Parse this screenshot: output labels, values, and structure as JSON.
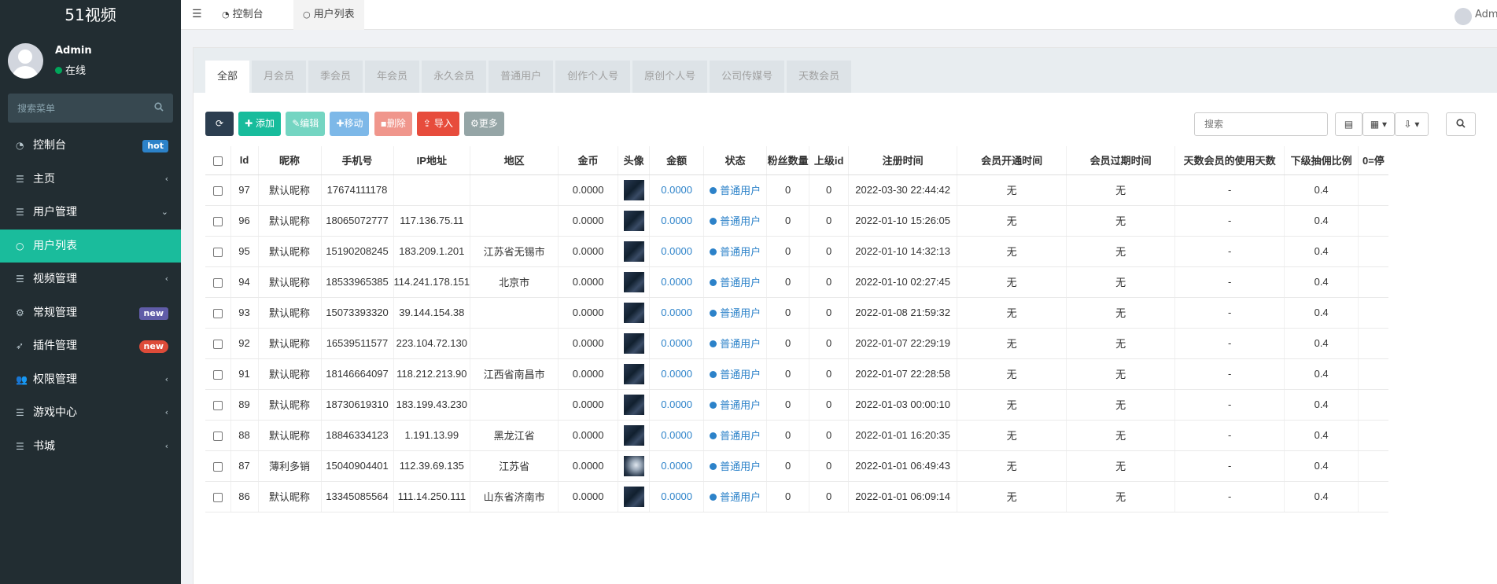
{
  "app": {
    "brand": "51视频",
    "user": {
      "name": "Admin",
      "status": "在线"
    },
    "search_placeholder": "搜索菜单"
  },
  "menu": [
    {
      "label": "控制台",
      "icon": "dashboard-icon",
      "badge": "hot"
    },
    {
      "label": "主页",
      "icon": "list-icon",
      "chevron": "left"
    },
    {
      "label": "用户管理",
      "icon": "list-icon",
      "chevron": "down"
    },
    {
      "label": "用户列表",
      "icon": "circle-icon",
      "active": true
    },
    {
      "label": "视频管理",
      "icon": "list-icon",
      "chevron": "left"
    },
    {
      "label": "常规管理",
      "icon": "gears-icon",
      "badge": "new"
    },
    {
      "label": "插件管理",
      "icon": "rocket-icon",
      "badge": "new"
    },
    {
      "label": "权限管理",
      "icon": "users-icon",
      "chevron": "left"
    },
    {
      "label": "游戏中心",
      "icon": "list-icon",
      "chevron": "left"
    },
    {
      "label": "书城",
      "icon": "list-icon",
      "chevron": "left"
    }
  ],
  "header": {
    "tabs": [
      "控制台",
      "用户列表"
    ],
    "user": "Admin"
  },
  "filter_tabs": [
    "全部",
    "月会员",
    "季会员",
    "年会员",
    "永久会员",
    "普通用户",
    "创作个人号",
    "原创个人号",
    "公司传媒号",
    "天数会员"
  ],
  "toolbar": {
    "add": "添加",
    "edit": "编辑",
    "move": "移动",
    "delete": "删除",
    "import": "导入",
    "more": "更多",
    "search_placeholder": "搜索"
  },
  "table": {
    "columns": [
      "Id",
      "昵称",
      "手机号",
      "IP地址",
      "地区",
      "金币",
      "头像",
      "金额",
      "状态",
      "粉丝数量",
      "上级id",
      "注册时间",
      "会员开通时间",
      "会员过期时间",
      "天数会员的使用天数",
      "下级抽佣比例",
      "0=停"
    ],
    "rows": [
      {
        "id": "97",
        "nick": "默认昵称",
        "phone": "17674111178",
        "ip": "",
        "region": "",
        "coin": "0.0000",
        "money": "0.0000",
        "status": "普通用户",
        "fans": "0",
        "parent": "0",
        "reg": "2022-03-30 22:44:42",
        "vip_open": "无",
        "vip_expire": "无",
        "days": "-",
        "ratio": "0.4"
      },
      {
        "id": "96",
        "nick": "默认昵称",
        "phone": "18065072777",
        "ip": "117.136.75.11",
        "region": "",
        "coin": "0.0000",
        "money": "0.0000",
        "status": "普通用户",
        "fans": "0",
        "parent": "0",
        "reg": "2022-01-10 15:26:05",
        "vip_open": "无",
        "vip_expire": "无",
        "days": "-",
        "ratio": "0.4"
      },
      {
        "id": "95",
        "nick": "默认昵称",
        "phone": "15190208245",
        "ip": "183.209.1.201",
        "region": "江苏省无锡市",
        "coin": "0.0000",
        "money": "0.0000",
        "status": "普通用户",
        "fans": "0",
        "parent": "0",
        "reg": "2022-01-10 14:32:13",
        "vip_open": "无",
        "vip_expire": "无",
        "days": "-",
        "ratio": "0.4"
      },
      {
        "id": "94",
        "nick": "默认昵称",
        "phone": "18533965385",
        "ip": "114.241.178.151",
        "region": "北京市",
        "coin": "0.0000",
        "money": "0.0000",
        "status": "普通用户",
        "fans": "0",
        "parent": "0",
        "reg": "2022-01-10 02:27:45",
        "vip_open": "无",
        "vip_expire": "无",
        "days": "-",
        "ratio": "0.4"
      },
      {
        "id": "93",
        "nick": "默认昵称",
        "phone": "15073393320",
        "ip": "39.144.154.38",
        "region": "",
        "coin": "0.0000",
        "money": "0.0000",
        "status": "普通用户",
        "fans": "0",
        "parent": "0",
        "reg": "2022-01-08 21:59:32",
        "vip_open": "无",
        "vip_expire": "无",
        "days": "-",
        "ratio": "0.4"
      },
      {
        "id": "92",
        "nick": "默认昵称",
        "phone": "16539511577",
        "ip": "223.104.72.130",
        "region": "",
        "coin": "0.0000",
        "money": "0.0000",
        "status": "普通用户",
        "fans": "0",
        "parent": "0",
        "reg": "2022-01-07 22:29:19",
        "vip_open": "无",
        "vip_expire": "无",
        "days": "-",
        "ratio": "0.4"
      },
      {
        "id": "91",
        "nick": "默认昵称",
        "phone": "18146664097",
        "ip": "118.212.213.90",
        "region": "江西省南昌市",
        "coin": "0.0000",
        "money": "0.0000",
        "status": "普通用户",
        "fans": "0",
        "parent": "0",
        "reg": "2022-01-07 22:28:58",
        "vip_open": "无",
        "vip_expire": "无",
        "days": "-",
        "ratio": "0.4"
      },
      {
        "id": "89",
        "nick": "默认昵称",
        "phone": "18730619310",
        "ip": "183.199.43.230",
        "region": "",
        "coin": "0.0000",
        "money": "0.0000",
        "status": "普通用户",
        "fans": "0",
        "parent": "0",
        "reg": "2022-01-03 00:00:10",
        "vip_open": "无",
        "vip_expire": "无",
        "days": "-",
        "ratio": "0.4"
      },
      {
        "id": "88",
        "nick": "默认昵称",
        "phone": "18846334123",
        "ip": "1.191.13.99",
        "region": "黑龙江省",
        "coin": "0.0000",
        "money": "0.0000",
        "status": "普通用户",
        "fans": "0",
        "parent": "0",
        "reg": "2022-01-01 16:20:35",
        "vip_open": "无",
        "vip_expire": "无",
        "days": "-",
        "ratio": "0.4"
      },
      {
        "id": "87",
        "nick": "薄利多销",
        "phone": "15040904401",
        "ip": "112.39.69.135",
        "region": "江苏省",
        "coin": "0.0000",
        "money": "0.0000",
        "status": "普通用户",
        "fans": "0",
        "parent": "0",
        "reg": "2022-01-01 06:49:43",
        "vip_open": "无",
        "vip_expire": "无",
        "days": "-",
        "ratio": "0.4"
      },
      {
        "id": "86",
        "nick": "默认昵称",
        "phone": "13345085564",
        "ip": "111.14.250.111",
        "region": "山东省济南市",
        "coin": "0.0000",
        "money": "0.0000",
        "status": "普通用户",
        "fans": "0",
        "parent": "0",
        "reg": "2022-01-01 06:09:14",
        "vip_open": "无",
        "vip_expire": "无",
        "days": "-",
        "ratio": "0.4"
      }
    ]
  },
  "colors": {
    "sidebar_bg": "#222d32",
    "active_menu": "#1abc9c",
    "link_blue": "#2c82c9",
    "online_green": "#00a65a"
  }
}
